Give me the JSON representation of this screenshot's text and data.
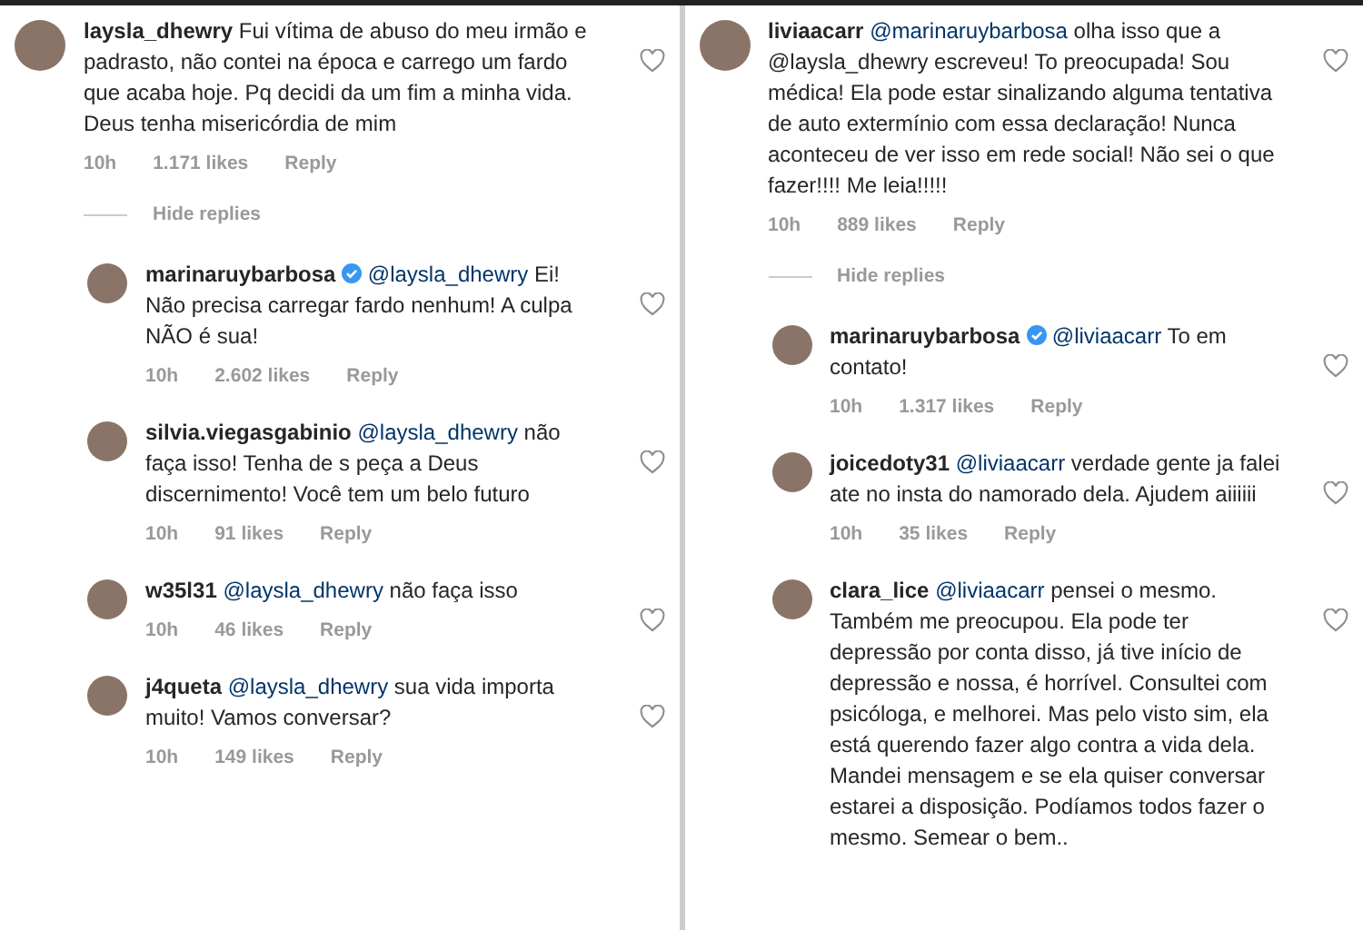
{
  "columns": [
    {
      "comment": {
        "user": "laysla_dhewry",
        "verified": false,
        "text": "Fui vítima de abuso do meu irmão e padrasto, não contei na época e carrego um fardo que acaba hoje. Pq decidi da um fim a minha vida. Deus tenha misericórdia de mim",
        "time": "10h",
        "likes": "1.171 likes",
        "reply": "Reply",
        "liked": false
      },
      "hide_replies": "Hide replies",
      "replies": [
        {
          "user": "marinaruybarbosa",
          "verified": true,
          "mention": "@laysla_dhewry",
          "text": "Ei! Não precisa carregar fardo nenhum! A culpa NÃO é sua!",
          "time": "10h",
          "likes": "2.602 likes",
          "reply": "Reply",
          "liked": false
        },
        {
          "user": "silvia.viegasgabinio",
          "verified": false,
          "mention": "@laysla_dhewry",
          "text": "não faça isso! Tenha de s peça a Deus discernimento! Você tem um belo futuro",
          "time": "10h",
          "likes": "91 likes",
          "reply": "Reply",
          "liked": false
        },
        {
          "user": "w35l31",
          "verified": false,
          "mention": "@laysla_dhewry",
          "text": "não faça isso",
          "time": "10h",
          "likes": "46 likes",
          "reply": "Reply",
          "liked": false
        },
        {
          "user": "j4queta",
          "verified": false,
          "mention": "@laysla_dhewry",
          "text": "sua vida importa muito! Vamos conversar?",
          "time": "10h",
          "likes": "149 likes",
          "reply": "Reply",
          "liked": false
        }
      ]
    },
    {
      "comment": {
        "user": "liviaacarr",
        "verified": false,
        "mention": "@marinaruybarbosa",
        "text": "olha isso que a @laysla_dhewry escreveu! To preocupada! Sou médica! Ela pode estar sinalizando alguma tentativa de auto extermínio com essa declaração! Nunca aconteceu de ver isso em rede social! Não sei o que fazer!!!! Me leia!!!!!",
        "time": "10h",
        "likes": "889 likes",
        "reply": "Reply",
        "liked": false
      },
      "hide_replies": "Hide replies",
      "replies": [
        {
          "user": "marinaruybarbosa",
          "verified": true,
          "mention": "@liviaacarr",
          "text": "To em contato!",
          "time": "10h",
          "likes": "1.317 likes",
          "reply": "Reply",
          "liked": false
        },
        {
          "user": "joicedoty31",
          "verified": false,
          "mention": "@liviaacarr",
          "text": "verdade gente ja falei ate no insta do namorado dela. Ajudem aiiiiii",
          "time": "10h",
          "likes": "35 likes",
          "reply": "Reply",
          "liked": false
        },
        {
          "user": "clara_lice",
          "verified": false,
          "mention": "@liviaacarr",
          "text": "pensei o mesmo. Também me preocupou. Ela pode ter depressão por conta disso, já tive início de depressão e nossa, é horrível. Consultei com psicóloga, e melhorei. Mas pelo visto sim, ela está querendo fazer algo contra a vida dela. Mandei mensagem e se ela quiser conversar estarei a disposição. Podíamos todos fazer o mesmo. Semear o bem..",
          "liked": false
        }
      ]
    }
  ]
}
